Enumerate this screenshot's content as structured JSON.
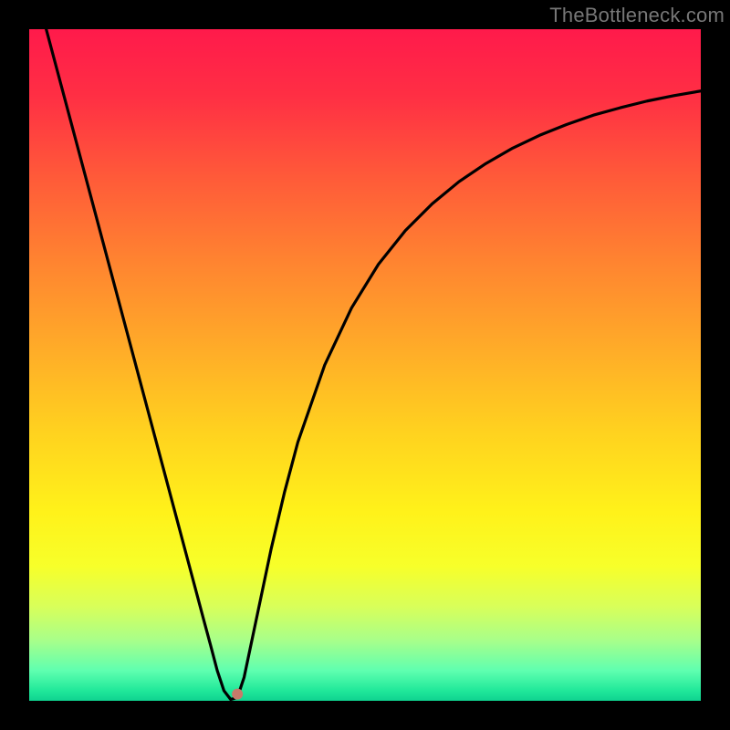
{
  "watermark": "TheBottleneck.com",
  "gradient": {
    "stops": [
      {
        "offset": 0.0,
        "color": "#ff1a4b"
      },
      {
        "offset": 0.1,
        "color": "#ff2f44"
      },
      {
        "offset": 0.22,
        "color": "#ff5a39"
      },
      {
        "offset": 0.35,
        "color": "#ff8530"
      },
      {
        "offset": 0.48,
        "color": "#ffad28"
      },
      {
        "offset": 0.6,
        "color": "#ffd21f"
      },
      {
        "offset": 0.72,
        "color": "#fff21a"
      },
      {
        "offset": 0.8,
        "color": "#f7ff2a"
      },
      {
        "offset": 0.86,
        "color": "#d8ff5a"
      },
      {
        "offset": 0.91,
        "color": "#a8ff8a"
      },
      {
        "offset": 0.955,
        "color": "#5fffb0"
      },
      {
        "offset": 0.985,
        "color": "#20e89a"
      },
      {
        "offset": 1.0,
        "color": "#0fd290"
      }
    ]
  },
  "chart_data": {
    "type": "line",
    "title": "",
    "xlabel": "",
    "ylabel": "",
    "xlim": [
      0,
      100
    ],
    "ylim": [
      0,
      100
    ],
    "x_min_at": 30,
    "marker": {
      "x": 31,
      "y": 1.0,
      "color": "#c77a6a",
      "r": 6
    },
    "series": [
      {
        "name": "curve",
        "x": [
          0,
          2,
          4,
          6,
          8,
          10,
          12,
          14,
          16,
          18,
          20,
          22,
          24,
          26,
          27,
          28,
          29,
          30,
          31,
          32,
          34,
          36,
          38,
          40,
          44,
          48,
          52,
          56,
          60,
          64,
          68,
          72,
          76,
          80,
          84,
          88,
          92,
          96,
          100
        ],
        "y": [
          110,
          102,
          94.5,
          87,
          79.5,
          72,
          64.5,
          57,
          49.5,
          42,
          34.5,
          27,
          19.5,
          12,
          8.3,
          4.5,
          1.5,
          0.2,
          0.5,
          3.5,
          13,
          22.5,
          31,
          38.5,
          50,
          58.5,
          65,
          70,
          74,
          77.3,
          80,
          82.3,
          84.2,
          85.8,
          87.2,
          88.3,
          89.3,
          90.1,
          90.8
        ]
      }
    ]
  }
}
